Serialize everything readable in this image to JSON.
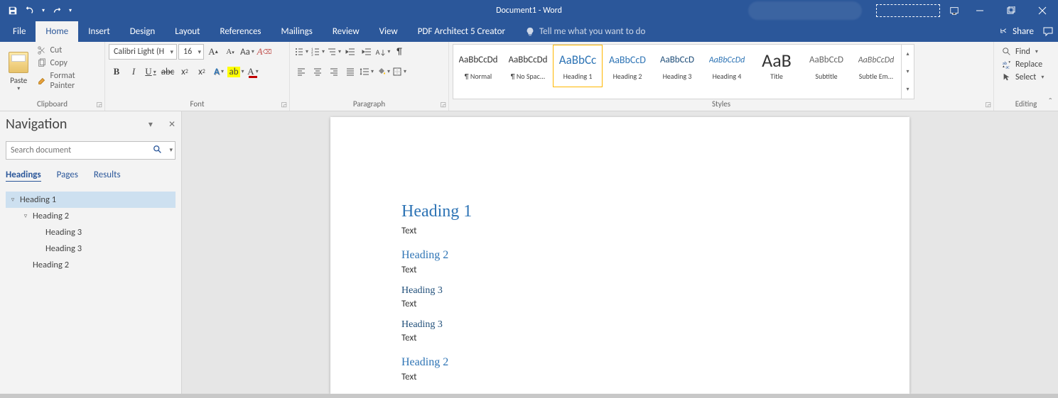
{
  "titlebar": {
    "title": "Document1 - Word"
  },
  "tabs": {
    "file": "File",
    "home": "Home",
    "insert": "Insert",
    "design": "Design",
    "layout": "Layout",
    "references": "References",
    "mailings": "Mailings",
    "review": "Review",
    "view": "View",
    "pdf": "PDF Architect 5 Creator",
    "tellme": "Tell me what you want to do",
    "share": "Share"
  },
  "clipboard": {
    "paste": "Paste",
    "cut": "Cut",
    "copy": "Copy",
    "format_painter": "Format Painter",
    "label": "Clipboard"
  },
  "font": {
    "name": "Calibri Light (H",
    "size": "16",
    "label": "Font"
  },
  "paragraph": {
    "label": "Paragraph"
  },
  "styles": {
    "label": "Styles",
    "items": [
      {
        "preview": "AaBbCcDd",
        "name": "¶ Normal",
        "color": "#333",
        "size": "13px"
      },
      {
        "preview": "AaBbCcDd",
        "name": "¶ No Spac...",
        "color": "#333",
        "size": "13px"
      },
      {
        "preview": "AaBbCc",
        "name": "Heading 1",
        "color": "#2e74b5",
        "size": "17px",
        "selected": true
      },
      {
        "preview": "AaBbCcD",
        "name": "Heading 2",
        "color": "#2e74b5",
        "size": "14px"
      },
      {
        "preview": "AaBbCcD",
        "name": "Heading 3",
        "color": "#1f4e79",
        "size": "13px"
      },
      {
        "preview": "AaBbCcDd",
        "name": "Heading 4",
        "color": "#2e74b5",
        "size": "12px",
        "italic": true
      },
      {
        "preview": "AaB",
        "name": "Title",
        "color": "#333",
        "size": "26px"
      },
      {
        "preview": "AaBbCcD",
        "name": "Subtitle",
        "color": "#666",
        "size": "13px"
      },
      {
        "preview": "AaBbCcDd",
        "name": "Subtle Em...",
        "color": "#666",
        "size": "12px",
        "italic": true
      }
    ]
  },
  "editing": {
    "find": "Find",
    "replace": "Replace",
    "select": "Select",
    "label": "Editing"
  },
  "nav": {
    "title": "Navigation",
    "search_placeholder": "Search document",
    "tabs": {
      "headings": "Headings",
      "pages": "Pages",
      "results": "Results"
    },
    "tree": [
      {
        "level": 0,
        "label": "Heading 1",
        "expander": "▿",
        "selected": true
      },
      {
        "level": 1,
        "label": "Heading 2",
        "expander": "▿"
      },
      {
        "level": 2,
        "label": "Heading 3"
      },
      {
        "level": 2,
        "label": "Heading 3"
      },
      {
        "level": 1,
        "label": "Heading 2"
      }
    ]
  },
  "doc": [
    {
      "type": "h1",
      "text": "Heading 1"
    },
    {
      "type": "body",
      "text": "Text"
    },
    {
      "type": "h2",
      "text": "Heading 2"
    },
    {
      "type": "body",
      "text": "Text"
    },
    {
      "type": "h3",
      "text": "Heading 3"
    },
    {
      "type": "body",
      "text": "Text"
    },
    {
      "type": "h3",
      "text": "Heading 3"
    },
    {
      "type": "body",
      "text": "Text"
    },
    {
      "type": "h2",
      "text": "Heading 2"
    },
    {
      "type": "body",
      "text": "Text"
    }
  ]
}
